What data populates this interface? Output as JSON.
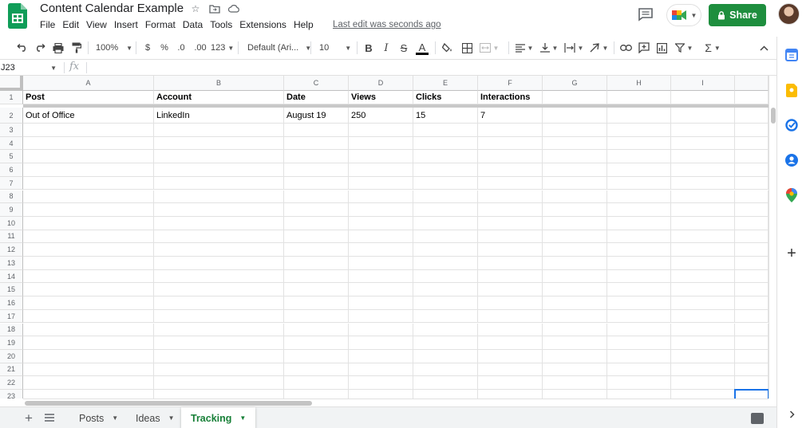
{
  "app": {
    "title": "Content Calendar Example",
    "last_edit": "Last edit was seconds ago"
  },
  "menu": [
    "File",
    "Edit",
    "View",
    "Insert",
    "Format",
    "Data",
    "Tools",
    "Extensions",
    "Help"
  ],
  "share": {
    "label": "Share"
  },
  "toolbar": {
    "zoom": "100%",
    "currency": "$",
    "percent": "%",
    "decrease_decimal": ".0",
    "increase_decimal": ".00",
    "number_format": "123",
    "font": "Default (Ari...",
    "font_size": "10",
    "bold": "B",
    "italic": "I",
    "strike": "S",
    "text_color": "A",
    "sum": "Σ"
  },
  "formula_bar": {
    "cell_ref": "J23",
    "fx": "fx",
    "content": ""
  },
  "columns": [
    "A",
    "B",
    "C",
    "D",
    "E",
    "F",
    "G",
    "H",
    "I"
  ],
  "rows": [
    "1",
    "2",
    "3",
    "4",
    "5",
    "6",
    "7",
    "8",
    "9",
    "10",
    "11",
    "12",
    "13",
    "14",
    "15",
    "16",
    "17",
    "18",
    "19",
    "20",
    "21",
    "22",
    "23"
  ],
  "cells": {
    "A1": "Post",
    "B1": "Account",
    "C1": "Date",
    "D1": "Views",
    "E1": "Clicks",
    "F1": "Interactions",
    "A2": "Out of Office",
    "B2": "LinkedIn",
    "C2": "August 19",
    "D2": "250",
    "E2": "15",
    "F2": "7"
  },
  "sheets": [
    {
      "name": "Posts",
      "active": false
    },
    {
      "name": "Ideas",
      "active": false
    },
    {
      "name": "Tracking",
      "active": true
    }
  ],
  "colors": {
    "accent": "#1e8e3e",
    "active_tab": "#188038",
    "selection": "#1a73e8",
    "header_bg": "#f8f9fa"
  }
}
